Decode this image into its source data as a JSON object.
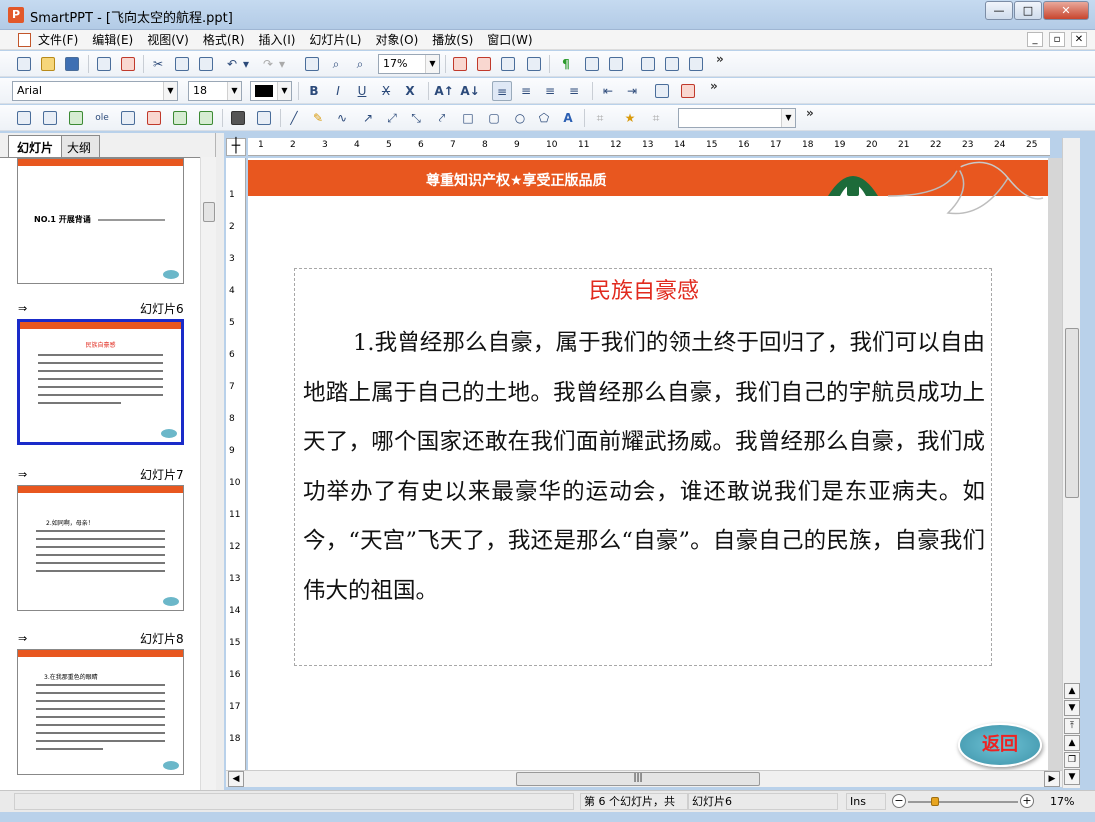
{
  "window": {
    "title": "SmartPPT - [飞向太空的航程.ppt]",
    "app_icon": "P"
  },
  "menu": [
    "文件(F)",
    "编辑(E)",
    "视图(V)",
    "格式(R)",
    "插入(I)",
    "幻灯片(L)",
    "对象(O)",
    "播放(S)",
    "窗口(W)"
  ],
  "toolbar": {
    "zoom": "17%",
    "font": "Arial",
    "size": "18",
    "more": "»"
  },
  "panel": {
    "tabs": [
      "幻灯片",
      "大纲"
    ],
    "thumbs": [
      {
        "label": "",
        "text": "NO.1 开展背诵"
      },
      {
        "label": "幻灯片6",
        "text": "民族自豪感"
      },
      {
        "label": "幻灯片7",
        "text": "2.如同啊，母亲！"
      },
      {
        "label": "幻灯片8",
        "text": "3.在我那重色的眼睛"
      }
    ]
  },
  "slide": {
    "banner": "尊重知识产权★享受正版品质",
    "heading": "民族自豪感",
    "body": "1.我曾经那么自豪，属于我们的领土终于回归了，我们可以自由地踏上属于自己的土地。我曾经那么自豪，我们自己的宇航员成功上天了，哪个国家还敢在我们面前耀武扬威。我曾经那么自豪，我们成功举办了有史以来最豪华的运动会，谁还敢说我们是东亚病夫。如今，“天宫”飞天了，我还是那么“自豪”。自豪自己的民族，自豪我们伟大的祖国。",
    "return_button": "返回"
  },
  "ruler": {
    "h": [
      "1",
      "2",
      "3",
      "4",
      "5",
      "6",
      "7",
      "8",
      "9",
      "10",
      "11",
      "12",
      "13",
      "14",
      "15",
      "16",
      "17",
      "18",
      "19",
      "20",
      "21",
      "22",
      "23",
      "24",
      "25"
    ],
    "v": [
      "1",
      "2",
      "3",
      "4",
      "5",
      "6",
      "7",
      "8",
      "9",
      "10",
      "11",
      "12",
      "13",
      "14",
      "15",
      "16",
      "17",
      "18"
    ]
  },
  "status": {
    "slide_pos": "第 6 个幻灯片，共",
    "slide_name": "幻灯片6",
    "mode": "Ins",
    "zoom": "17%"
  },
  "colors": {
    "accent": "#e8571f",
    "heading": "#e12a1e",
    "selection": "#1a2bc9"
  }
}
